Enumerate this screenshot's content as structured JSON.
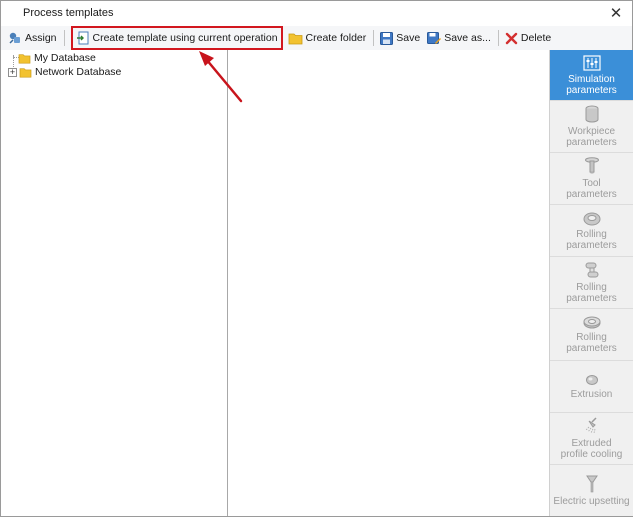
{
  "window": {
    "title": "Process templates",
    "close_glyph": "✕"
  },
  "toolbar": {
    "assign_label": "Assign",
    "create_template_label": "Create template using current operation",
    "create_folder_label": "Create folder",
    "save_label": "Save",
    "save_as_label": "Save as...",
    "delete_label": "Delete"
  },
  "tree": {
    "items": [
      {
        "label": "My Database",
        "icon": "folder-icon",
        "expandable": false
      },
      {
        "label": "Network Database",
        "icon": "folder-icon",
        "expandable": true,
        "expander_glyph": "+"
      }
    ]
  },
  "sidebar": {
    "items": [
      {
        "label_line1": "Simulation",
        "label_line2": "parameters",
        "icon": "simulation-parameters-icon",
        "active": true
      },
      {
        "label_line1": "Workpiece",
        "label_line2": "parameters",
        "icon": "workpiece-cylinder-icon",
        "active": false
      },
      {
        "label_line1": "Tool",
        "label_line2": "parameters",
        "icon": "tool-punch-icon",
        "active": false
      },
      {
        "label_line1": "Rolling",
        "label_line2": "parameters",
        "icon": "rolling-ring-icon",
        "active": false
      },
      {
        "label_line1": "Rolling",
        "label_line2": "parameters",
        "icon": "rolling-rollers-icon",
        "active": false
      },
      {
        "label_line1": "Rolling",
        "label_line2": "parameters",
        "icon": "rolling-disk-icon",
        "active": false
      },
      {
        "label_line1": "Extrusion",
        "label_line2": "",
        "icon": "extrusion-icon",
        "active": false
      },
      {
        "label_line1": "Extruded",
        "label_line2": "profile cooling",
        "icon": "shower-cooling-icon",
        "active": false
      },
      {
        "label_line1": "Electric upsetting",
        "label_line2": "",
        "icon": "electric-upsetting-icon",
        "active": false
      }
    ]
  },
  "colors": {
    "accent_active": "#3b8fd8",
    "highlight_box": "#d2171f",
    "annotation_arrow": "#c8141c",
    "folder": "#f2c230"
  }
}
